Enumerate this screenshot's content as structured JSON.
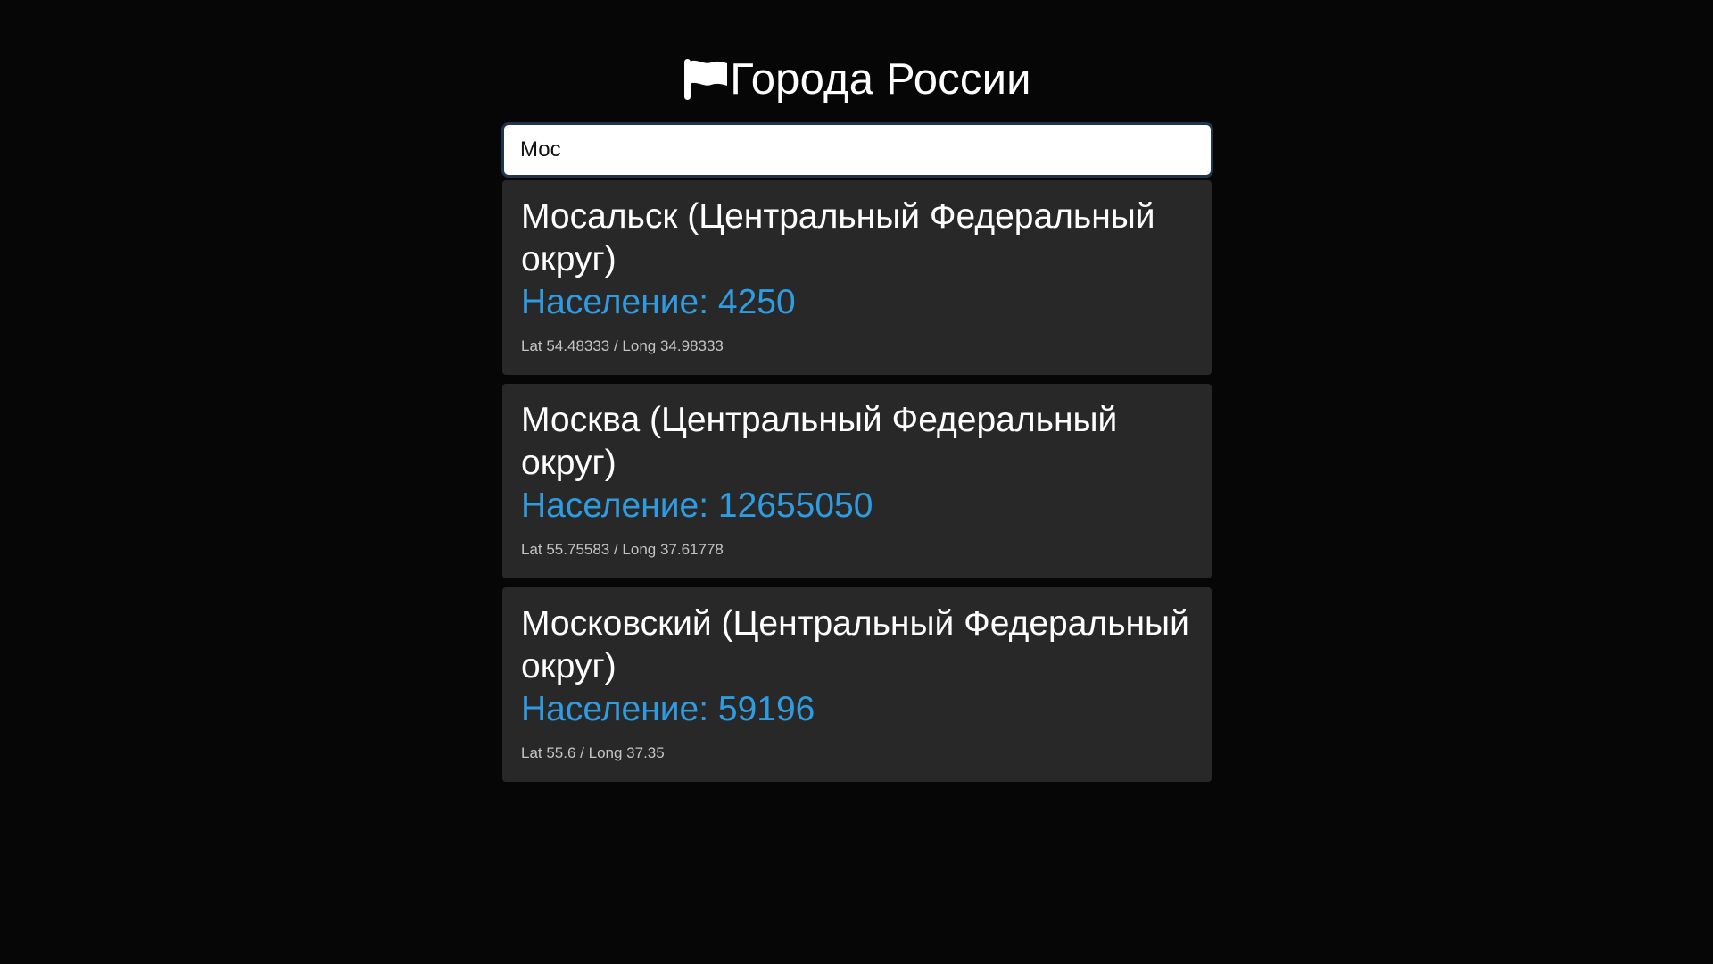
{
  "header": {
    "title": "Города России",
    "icon": "flag-icon"
  },
  "search": {
    "value": "Мос",
    "placeholder": ""
  },
  "colors": {
    "background": "#060606",
    "card": "#282828",
    "accent": "#2f9be0",
    "search_border": "#1d3650"
  },
  "results": [
    {
      "name": "Мосальск (Центральный Федеральный округ)",
      "population": "Население: 4250",
      "coords": "Lat 54.48333 / Long 34.98333"
    },
    {
      "name": "Москва (Центральный Федеральный округ)",
      "population": "Население: 12655050",
      "coords": "Lat 55.75583 / Long 37.61778"
    },
    {
      "name": "Московский (Центральный Федеральный округ)",
      "population": "Население: 59196",
      "coords": "Lat 55.6 / Long 37.35"
    }
  ]
}
